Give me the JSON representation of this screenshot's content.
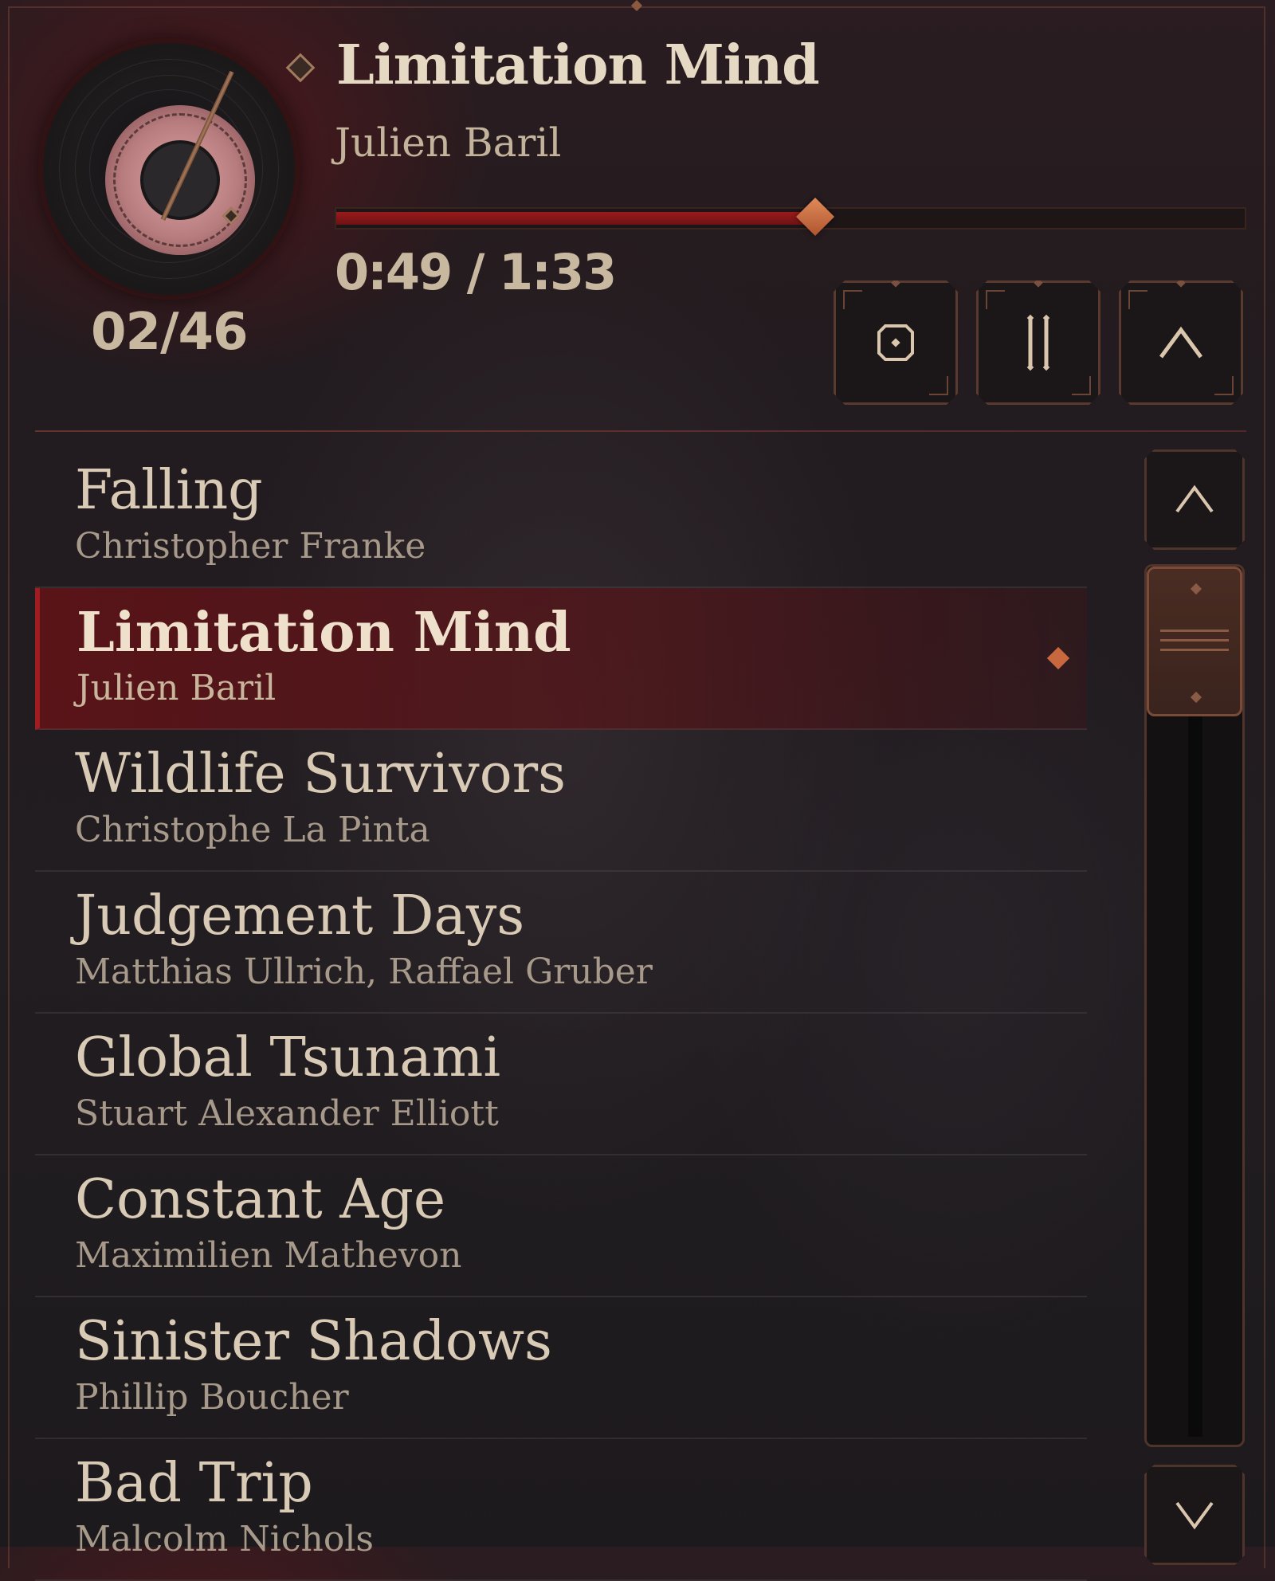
{
  "player": {
    "track_counter": "02/46",
    "now_playing": {
      "title": "Limitation Mind",
      "artist": "Julien Baril"
    },
    "time": "0:49 / 1:33",
    "progress_fraction": 0.527,
    "controls": [
      {
        "name": "stop-button",
        "icon": "stop-icon"
      },
      {
        "name": "pause-button",
        "icon": "pause-icon"
      },
      {
        "name": "collapse-button",
        "icon": "chevron-up-icon"
      }
    ]
  },
  "playlist": {
    "active_index": 1,
    "tracks": [
      {
        "title": "Falling",
        "artist": "Christopher Franke"
      },
      {
        "title": "Limitation Mind",
        "artist": "Julien Baril"
      },
      {
        "title": "Wildlife Survivors",
        "artist": "Christophe La Pinta"
      },
      {
        "title": "Judgement Days",
        "artist": "Matthias Ullrich, Raffael Gruber"
      },
      {
        "title": "Global Tsunami",
        "artist": "Stuart Alexander Elliott"
      },
      {
        "title": "Constant Age",
        "artist": "Maximilien Mathevon"
      },
      {
        "title": "Sinister Shadows",
        "artist": "Phillip Boucher"
      },
      {
        "title": "Bad Trip",
        "artist": "Malcolm Nichols"
      }
    ]
  },
  "scrollbar": {
    "up_icon": "chevron-up-icon",
    "down_icon": "chevron-down-icon",
    "position_fraction": 0.0
  },
  "colors": {
    "accent": "#c8683e",
    "active_row": "#6e1214",
    "progress_fill": "#9a1a1c",
    "text_primary": "#d8cab4",
    "text_secondary": "#a79a8a"
  }
}
